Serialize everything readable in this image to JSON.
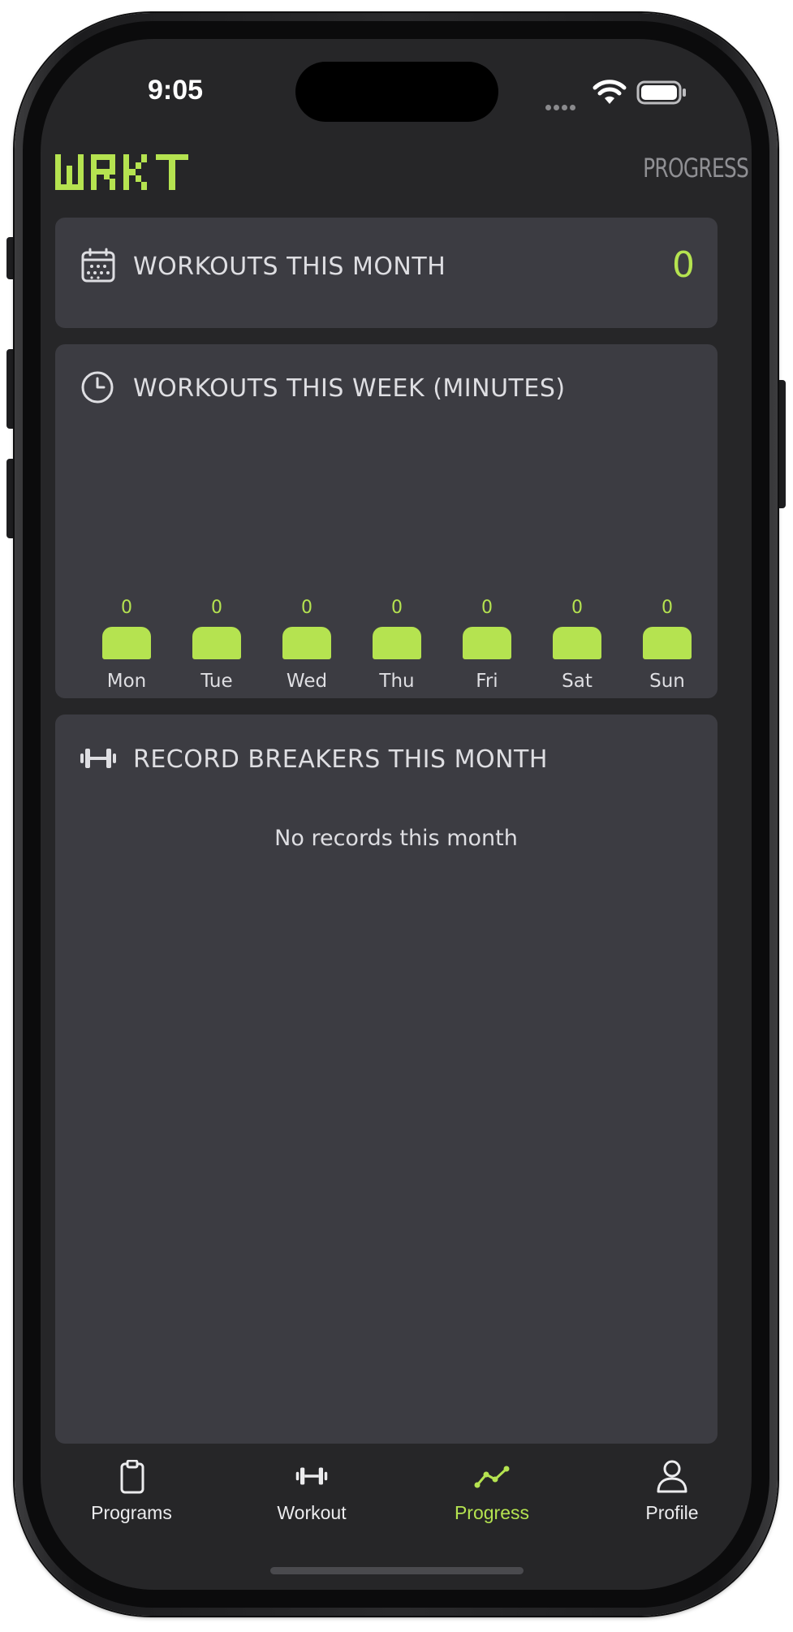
{
  "status_bar": {
    "time": "9:05"
  },
  "header": {
    "logo": "WRKT",
    "page_label": "PROGRESS"
  },
  "monthly_workouts": {
    "title": "WORKOUTS THIS MONTH",
    "value": "0",
    "icon": "calendar-icon"
  },
  "weekly_minutes": {
    "title": "WORKOUTS THIS WEEK (MINUTES)",
    "icon": "clock-icon"
  },
  "chart_data": {
    "type": "bar",
    "categories": [
      "Mon",
      "Tue",
      "Wed",
      "Thu",
      "Fri",
      "Sat",
      "Sun"
    ],
    "values": [
      0,
      0,
      0,
      0,
      0,
      0,
      0
    ],
    "value_labels": [
      "0",
      "0",
      "0",
      "0",
      "0",
      "0",
      "0"
    ],
    "bar_color": "#b5e350"
  },
  "records": {
    "title": "RECORD BREAKERS THIS MONTH",
    "icon": "dumbbell-icon",
    "empty_message": "No records this month"
  },
  "tab_bar": {
    "tabs": [
      {
        "label": "Programs",
        "icon": "clipboard-icon",
        "active": false
      },
      {
        "label": "Workout",
        "icon": "dumbbell-icon",
        "active": false
      },
      {
        "label": "Progress",
        "icon": "trend-line-icon",
        "active": true
      },
      {
        "label": "Profile",
        "icon": "person-icon",
        "active": false
      }
    ]
  },
  "colors": {
    "accent": "#b5e350",
    "background": "#262628",
    "card": "#3c3c42",
    "text": "#dedee2",
    "muted": "#8f8f93"
  }
}
